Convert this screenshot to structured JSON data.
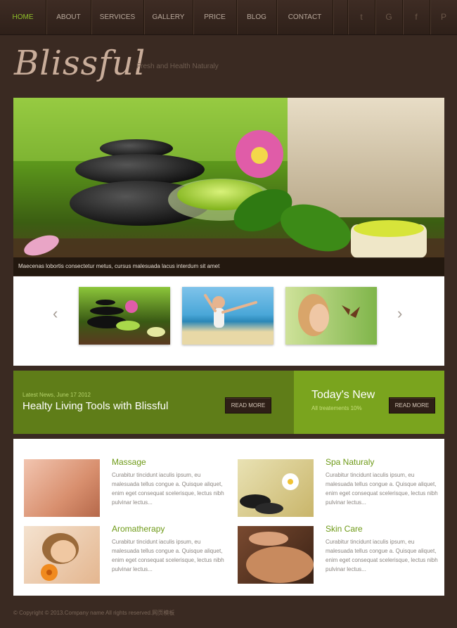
{
  "nav": {
    "items": [
      {
        "label": "HOME",
        "active": true
      },
      {
        "label": "ABOUT",
        "active": false
      },
      {
        "label": "SERVICES",
        "active": false
      },
      {
        "label": "GALLERY",
        "active": false
      },
      {
        "label": "PRICE",
        "active": false
      },
      {
        "label": "BLOG",
        "active": false
      },
      {
        "label": "CONTACT",
        "active": false
      }
    ],
    "social": [
      {
        "icon": "twitter-icon",
        "glyph": "t"
      },
      {
        "icon": "google-icon",
        "glyph": "G"
      },
      {
        "icon": "facebook-icon",
        "glyph": "f"
      },
      {
        "icon": "pinterest-icon",
        "glyph": "P"
      }
    ]
  },
  "brand": {
    "logo": "Blissful",
    "tagline": "Fresh and Health Naturaly"
  },
  "hero": {
    "caption": "Maecenas lobortis consectetur metus, cursus malesuada lacus interdum sit amet"
  },
  "carousel": {
    "prev_glyph": "‹",
    "next_glyph": "›"
  },
  "news": {
    "date": "Latest News, June 17 2012",
    "title": "Healty Living Tools with Blissful",
    "button": "READ MORE"
  },
  "today": {
    "title": "Today's New",
    "subtitle": "All treatements 10%",
    "button": "READ MORE"
  },
  "services": [
    {
      "title": "Massage",
      "text": "Curabitur tincidunt iaculis ipsum, eu malesuada tellus congue a. Quisque aliquet, enim eget consequat scelerisque, lectus nibh pulvinar lectus..."
    },
    {
      "title": "Spa Naturaly",
      "text": "Curabitur tincidunt iaculis ipsum, eu malesuada tellus congue a. Quisque aliquet, enim eget consequat scelerisque, lectus nibh pulvinar lectus..."
    },
    {
      "title": "Aromatherapy",
      "text": "Curabitur tincidunt iaculis ipsum, eu malesuada tellus congue a. Quisque aliquet, enim eget consequat scelerisque, lectus nibh pulvinar lectus..."
    },
    {
      "title": "Skin Care",
      "text": "Curabitur tincidunt iaculis ipsum, eu malesuada tellus congue a. Quisque aliquet, enim eget consequat scelerisque, lectus nibh pulvinar lectus..."
    }
  ],
  "footer": {
    "copyright": "© Copyright © 2013.Company name All rights reserved.网页模板"
  },
  "colors": {
    "accent": "#8fbf2a",
    "background": "#3a2a22",
    "news_bar": "#5f7d18",
    "today_bar": "#7aa41e"
  }
}
